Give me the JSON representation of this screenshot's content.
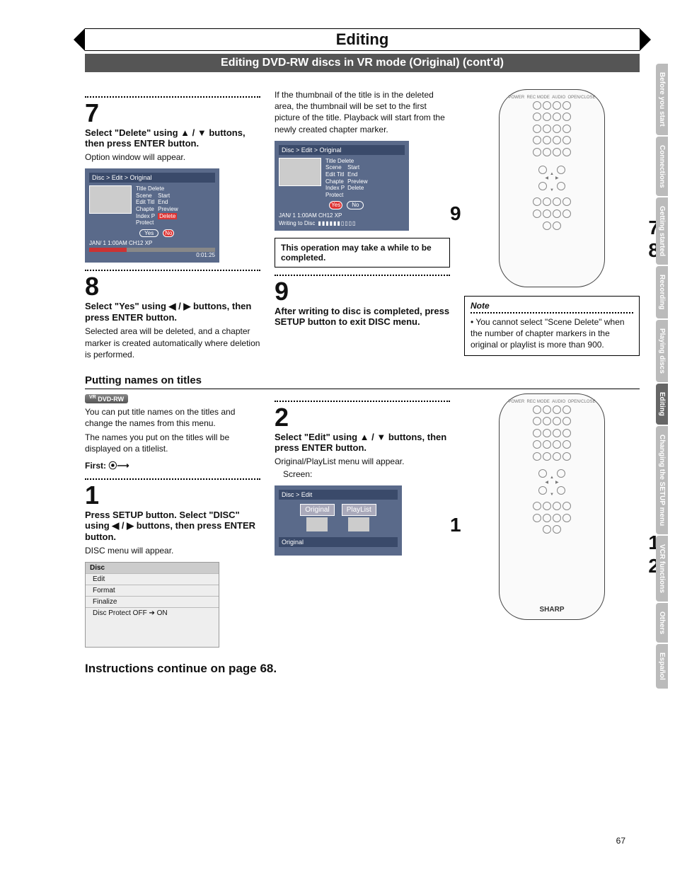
{
  "header": {
    "title": "Editing",
    "subtitle": "Editing DVD-RW discs in VR mode (Original) (cont'd)"
  },
  "step7": {
    "num": "7",
    "head": "Select \"Delete\" using ▲ / ▼ buttons, then press ENTER button.",
    "body": "Option window will appear.",
    "osd": {
      "breadcrumb": "Disc > Edit > Original",
      "menu_title": "Title Delete",
      "items": [
        "Scene",
        "Edit Titl",
        "Chapte",
        "Index P",
        "Protect"
      ],
      "right_items": [
        "Start",
        "End",
        "Preview",
        "Delete"
      ],
      "yes": "Yes",
      "no": "No",
      "status": "JAN/ 1   1:00AM  CH12     XP",
      "timer": "0:01:25"
    }
  },
  "step8": {
    "num": "8",
    "head": "Select \"Yes\" using ◀ / ▶ buttons, then press ENTER button.",
    "body": "Selected area will be deleted, and a chapter marker is created automatically where deletion is performed."
  },
  "midcol": {
    "para": "If the thumbnail of the title is in the deleted area, the thumbnail will be set to the first picture of the title. Playback will start from the newly created chapter marker.",
    "osd": {
      "breadcrumb": "Disc > Edit > Original",
      "menu_title": "Title Delete",
      "items": [
        "Scene",
        "Edit Titl",
        "Chapte",
        "Index P",
        "Protect"
      ],
      "right_items": [
        "Start",
        "End",
        "Preview",
        "Delete"
      ],
      "yes": "Yes",
      "no": "No",
      "status": "JAN/ 1   1:00AM  CH12     XP",
      "writing": "Writing to Disc"
    },
    "callout": "This operation may take a while to be completed."
  },
  "step9": {
    "num": "9",
    "head": "After writing to disc is completed, press SETUP button to exit DISC menu."
  },
  "remote1": {
    "left": "9",
    "right_top": "7",
    "right_bot": "8"
  },
  "note": {
    "title": "Note",
    "body": "• You cannot select \"Scene Delete\" when the number of chapter markers in the original or playlist is more than 900."
  },
  "section2": {
    "title": "Putting names on titles",
    "badge": "DVD-RW",
    "badge_sup": "VR",
    "intro1": "You can put title names on the titles and change the names from this menu.",
    "intro2": "The names you put on the titles will be displayed on a titlelist.",
    "first": "First:"
  },
  "step1": {
    "num": "1",
    "head": "Press SETUP button. Select \"DISC\" using ◀ / ▶ buttons, then press ENTER button.",
    "body": "DISC menu will appear.",
    "menu": {
      "header": "Disc",
      "items": [
        "Edit",
        "Format",
        "Finalize",
        "Disc Protect OFF ➔ ON"
      ]
    }
  },
  "step2": {
    "num": "2",
    "head": "Select \"Edit\" using ▲ / ▼ buttons, then press ENTER button.",
    "body": "Original/PlayList menu will appear.",
    "screen_label": "Screen:",
    "osd": {
      "breadcrumb": "Disc > Edit",
      "opt1": "Original",
      "opt2": "PlayList",
      "footer": "Original"
    }
  },
  "remote2": {
    "left": "1",
    "right_top": "1",
    "right_bot": "2",
    "brand": "SHARP"
  },
  "footer": "Instructions continue on page 68.",
  "page_num": "67",
  "tabs": [
    "Before you start",
    "Connections",
    "Getting started",
    "Recording",
    "Playing discs",
    "Editing",
    "Changing the SETUP menu",
    "VCR functions",
    "Others",
    "Español"
  ]
}
